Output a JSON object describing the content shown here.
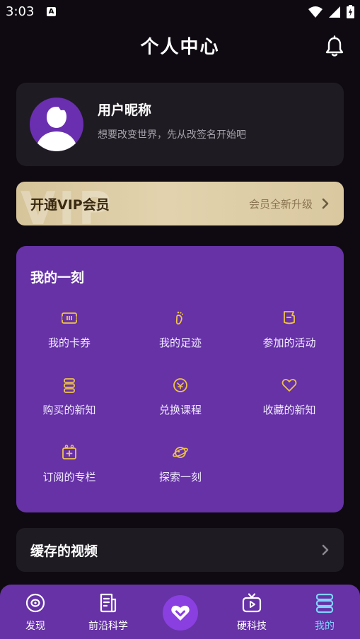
{
  "status": {
    "time": "3:03",
    "notif_letter": "A"
  },
  "header": {
    "title": "个人中心"
  },
  "user": {
    "name": "用户昵称",
    "motto": "想要改变世界，先从改签名开始吧"
  },
  "vip": {
    "watermark": "VIP",
    "title": "开通VIP会员",
    "subtitle": "会员全新升级"
  },
  "moment": {
    "title": "我的一刻",
    "items": [
      {
        "label": "我的卡券",
        "icon": "ticket-icon"
      },
      {
        "label": "我的足迹",
        "icon": "footprint-icon"
      },
      {
        "label": "参加的活动",
        "icon": "flag-icon"
      },
      {
        "label": "购买的新知",
        "icon": "stack-icon"
      },
      {
        "label": "兑换课程",
        "icon": "exchange-icon"
      },
      {
        "label": "收藏的新知",
        "icon": "heart-icon"
      },
      {
        "label": "订阅的专栏",
        "icon": "subscribe-icon"
      },
      {
        "label": "探索一刻",
        "icon": "planet-icon"
      }
    ]
  },
  "cache": {
    "title": "缓存的视频"
  },
  "tabs": [
    {
      "label": "发现",
      "icon": "discover-icon"
    },
    {
      "label": "前沿科学",
      "icon": "article-icon"
    },
    {
      "label": "",
      "icon": "heart-chevron-icon"
    },
    {
      "label": "硬科技",
      "icon": "tv-icon"
    },
    {
      "label": "我的",
      "icon": "stack-icon",
      "active": true
    }
  ],
  "colors": {
    "accent": "#6632a6",
    "icon_gold": "#f0c24a",
    "active_tab": "#7fd3ff",
    "card": "#1f1b22"
  }
}
